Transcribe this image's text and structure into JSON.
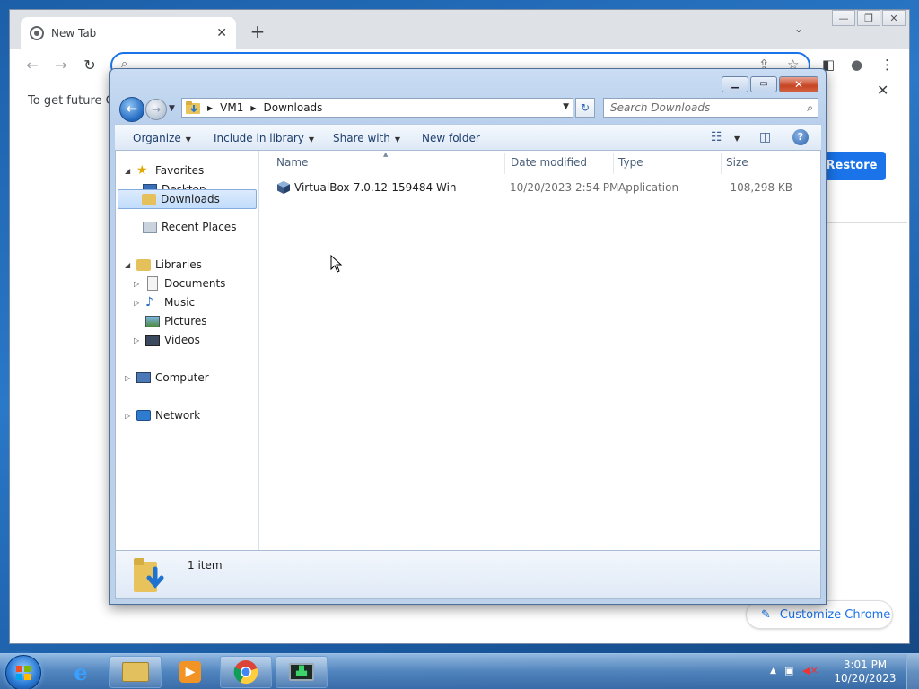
{
  "chrome": {
    "tab_title": "New Tab",
    "tab_close": "✕",
    "new_tab": "+",
    "tab_search": "⌄",
    "window_controls": [
      "—",
      "❐",
      "✕"
    ],
    "notice_text": "To get future Go",
    "restore_label": "Restore",
    "notice_close": "✕",
    "customize_label": "Customize Chrome"
  },
  "explorer": {
    "breadcrumb": [
      "VM1",
      "Downloads"
    ],
    "search_placeholder": "Search Downloads",
    "commands": {
      "organize": "Organize",
      "include_in_library": "Include in library",
      "share_with": "Share with",
      "new_folder": "New folder"
    },
    "nav": {
      "favorites": "Favorites",
      "desktop": "Desktop",
      "downloads": "Downloads",
      "recent_places": "Recent Places",
      "libraries": "Libraries",
      "documents": "Documents",
      "music": "Music",
      "pictures": "Pictures",
      "videos": "Videos",
      "computer": "Computer",
      "network": "Network"
    },
    "columns": {
      "name": "Name",
      "date_modified": "Date modified",
      "type": "Type",
      "size": "Size"
    },
    "files": [
      {
        "name": "VirtualBox-7.0.12-159484-Win",
        "date_modified": "10/20/2023 2:54 PM",
        "type": "Application",
        "size": "108,298 KB"
      }
    ],
    "item_count": "1 item"
  },
  "taskbar": {
    "clock_time": "3:01 PM",
    "clock_date": "10/20/2023"
  },
  "colors": {
    "chrome_blue": "#1a73e8",
    "taskbar_glass": "#5a8cc3"
  }
}
